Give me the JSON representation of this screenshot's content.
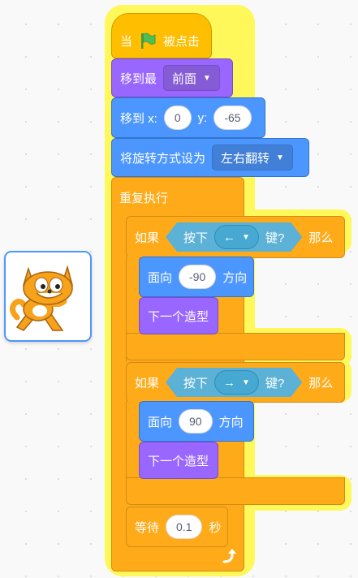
{
  "workspace": {
    "background_color": "#f9f9f9",
    "highlight_color": "#fff85a"
  },
  "sprite_thumbnail": {
    "name": "cat-sprite",
    "selected": true
  },
  "script": {
    "when_flag": {
      "prefix": "当",
      "icon": "green-flag-icon",
      "suffix": "被点击"
    },
    "go_to_layer": {
      "label": "移到最",
      "value": "前面"
    },
    "go_to_xy": {
      "label_x": "移到 x:",
      "x": "0",
      "label_y": "y:",
      "y": "-65"
    },
    "rotation_style": {
      "label": "将旋转方式设为",
      "value": "左右翻转"
    },
    "forever": {
      "label": "重复执行",
      "loop_icon": "loop-arrow-icon"
    },
    "if1": {
      "if_label": "如果",
      "key_prefix": "按下",
      "key_value": "←",
      "key_suffix": "键?",
      "then_label": "那么",
      "point_label": "面向",
      "point_value": "-90",
      "point_suffix": "方向",
      "costume_label": "下一个造型"
    },
    "if2": {
      "if_label": "如果",
      "key_prefix": "按下",
      "key_value": "→",
      "key_suffix": "键?",
      "then_label": "那么",
      "point_label": "面向",
      "point_value": "90",
      "point_suffix": "方向",
      "costume_label": "下一个造型"
    },
    "wait": {
      "label": "等待",
      "value": "0.1",
      "unit": "秒"
    }
  },
  "colors": {
    "events": "#ffbf00",
    "looks": "#9966ff",
    "motion": "#4c97ff",
    "control": "#ffab19",
    "sensing": "#5cb1d6"
  }
}
